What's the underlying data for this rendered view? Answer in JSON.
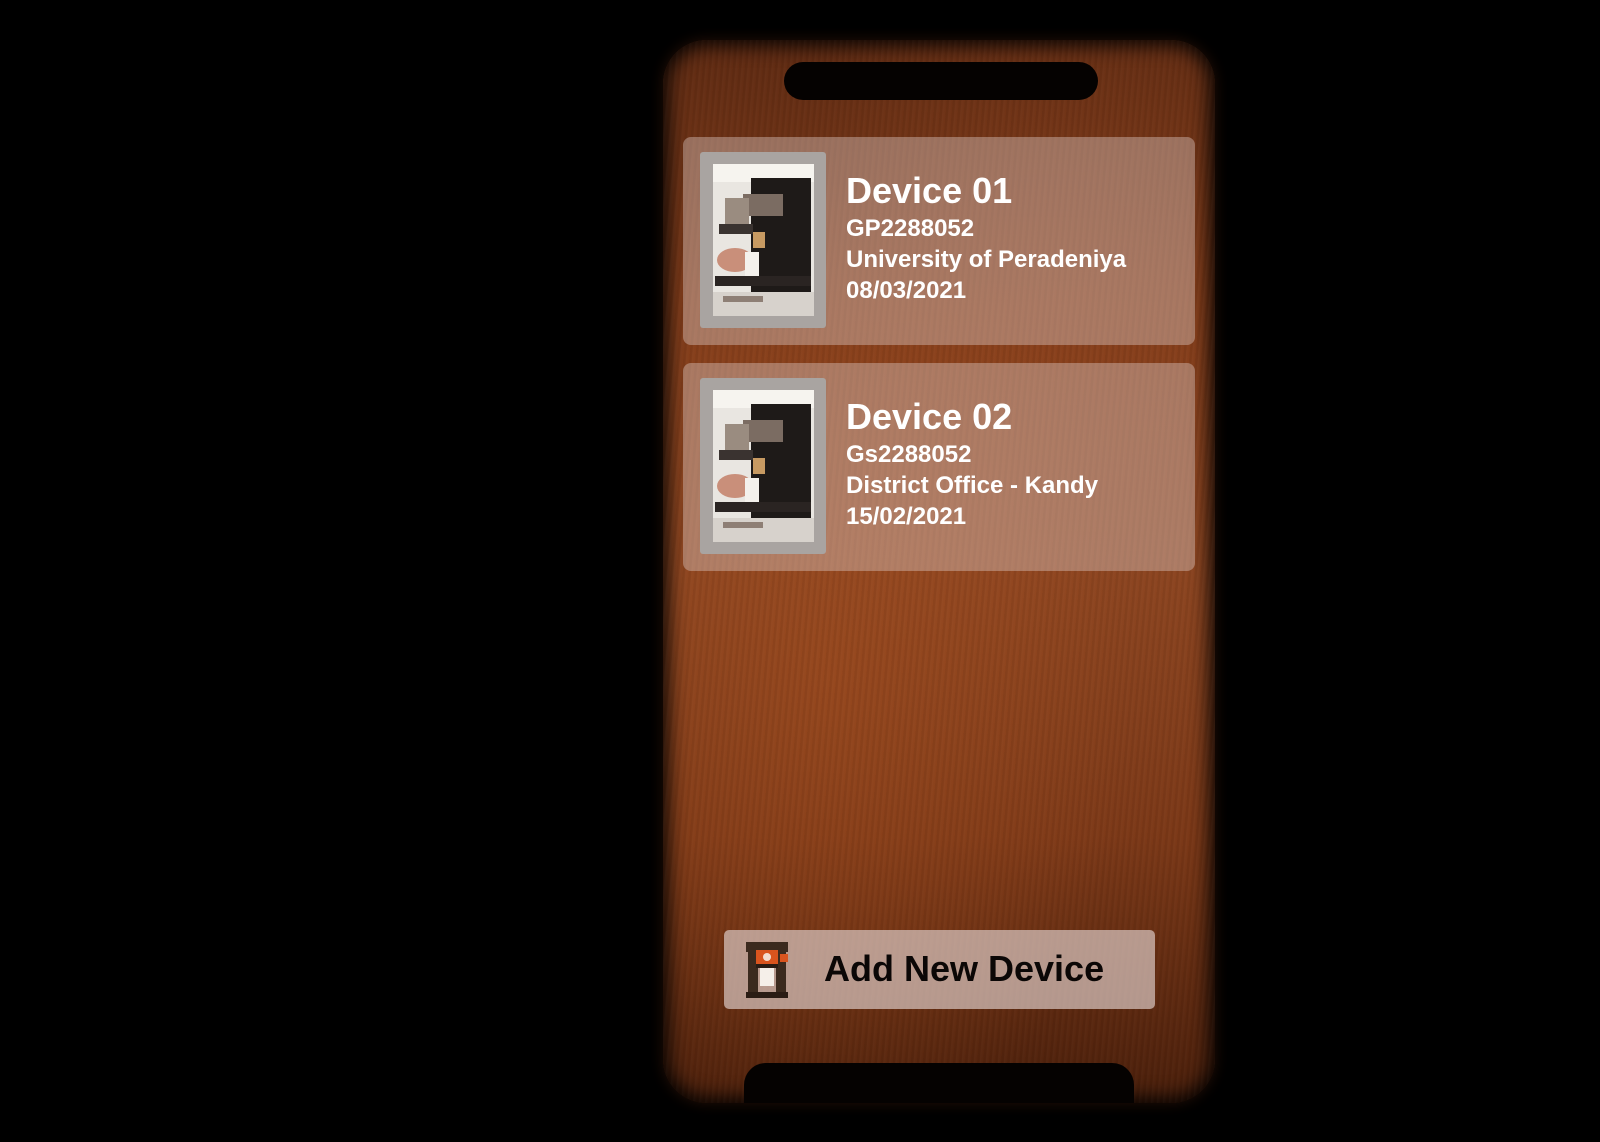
{
  "devices": [
    {
      "name": "Device 01",
      "code": "GP2288052",
      "location": "University of Peradeniya",
      "date": "08/03/2021",
      "image_icon": "coffee-machine-photo"
    },
    {
      "name": "Device 02",
      "code": "Gs2288052",
      "location": "District Office - Kandy",
      "date": "15/02/2021",
      "image_icon": "coffee-machine-photo"
    }
  ],
  "add_button": {
    "label": "Add New Device",
    "icon": "coffee-machine-icon"
  },
  "colors": {
    "card_text": "#ffffff",
    "button_text": "#0b0706",
    "background": "#000000",
    "phone_wood": "#803b19",
    "icon_orange": "#d9541e"
  }
}
